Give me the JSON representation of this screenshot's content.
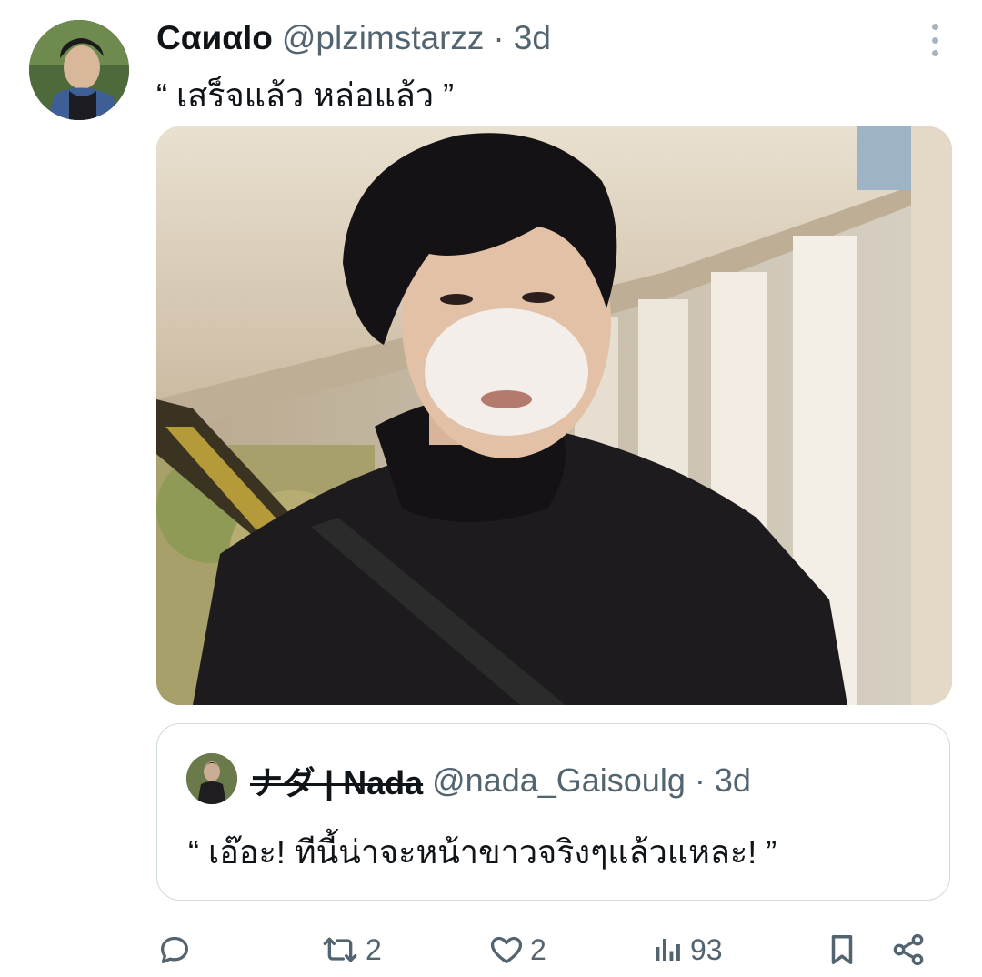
{
  "tweet": {
    "display_name": "Cαиαlo",
    "handle": "@plzimstarzz",
    "separator": "·",
    "time": "3d",
    "text": "“ เสร็จแล้ว หล่อแล้ว ”"
  },
  "quoted_tweet": {
    "display_name": "ナダ | Nada",
    "handle": "@nada_Gaisoulg",
    "separator": "·",
    "time": "3d",
    "text": "“ เอ๊อะ! ทีนี้น่าจะหน้าขาวจริงๆแล้วแหละ! ”"
  },
  "actions": {
    "reply_count": "",
    "retweet_count": "2",
    "like_count": "2",
    "views_count": "93"
  },
  "icons": {
    "more": "more-vertical-icon",
    "reply": "reply-icon",
    "retweet": "retweet-icon",
    "like": "heart-icon",
    "views": "views-icon",
    "bookmark": "bookmark-icon",
    "share": "share-icon"
  },
  "colors": {
    "text_primary": "#0f1419",
    "text_secondary": "#536471",
    "border": "#cfd9de"
  }
}
